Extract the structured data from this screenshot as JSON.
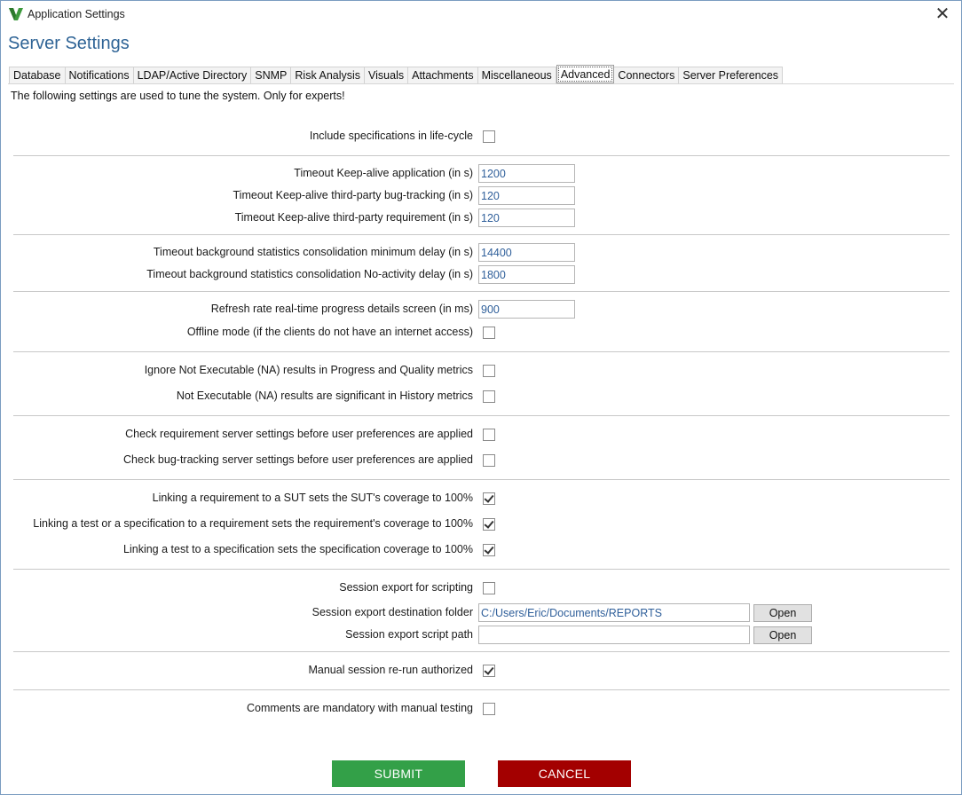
{
  "window": {
    "title": "Application Settings",
    "close_glyph": "✕"
  },
  "page_title": "Server Settings",
  "tabs": [
    {
      "label": "Database"
    },
    {
      "label": "Notifications"
    },
    {
      "label": "LDAP/Active Directory"
    },
    {
      "label": "SNMP"
    },
    {
      "label": "Risk Analysis"
    },
    {
      "label": "Visuals"
    },
    {
      "label": "Attachments"
    },
    {
      "label": "Miscellaneous"
    },
    {
      "label": "Advanced",
      "active": true
    },
    {
      "label": "Connectors"
    },
    {
      "label": "Server Preferences"
    }
  ],
  "intro": "The following settings are used to tune the system. Only for experts!",
  "settings": {
    "include_specs": {
      "label": "Include specifications in life-cycle",
      "checked": false
    },
    "timeout_app": {
      "label": "Timeout Keep-alive application (in s)",
      "value": "1200"
    },
    "timeout_bug": {
      "label": "Timeout Keep-alive third-party bug-tracking (in s)",
      "value": "120"
    },
    "timeout_req": {
      "label": "Timeout Keep-alive third-party requirement (in s)",
      "value": "120"
    },
    "bg_min_delay": {
      "label": "Timeout background statistics consolidation minimum delay (in s)",
      "value": "14400"
    },
    "bg_noact_delay": {
      "label": "Timeout background statistics consolidation No-activity delay (in s)",
      "value": "1800"
    },
    "refresh_rate": {
      "label": "Refresh rate real-time progress details screen (in ms)",
      "value": "900"
    },
    "offline_mode": {
      "label": "Offline mode (if the clients do not have an internet access)",
      "checked": false
    },
    "ignore_na": {
      "label": "Ignore Not Executable (NA) results in Progress and Quality metrics",
      "checked": false
    },
    "na_history": {
      "label": "Not Executable (NA) results are significant in History metrics",
      "checked": false
    },
    "check_req": {
      "label": "Check requirement server settings before user preferences are applied",
      "checked": false
    },
    "check_bug": {
      "label": "Check bug-tracking server settings before user preferences are applied",
      "checked": false
    },
    "link_req_sut": {
      "label": "Linking a requirement to a SUT sets the SUT's coverage to 100%",
      "checked": true
    },
    "link_test_req": {
      "label": "Linking a test or a specification to a requirement sets the requirement's coverage to 100%",
      "checked": true
    },
    "link_test_spec": {
      "label": "Linking a test to a specification sets the specification coverage to 100%",
      "checked": true
    },
    "session_export": {
      "label": "Session export for scripting",
      "checked": false
    },
    "export_folder": {
      "label": "Session export destination folder",
      "value": "C:/Users/Eric/Documents/REPORTS",
      "button": "Open"
    },
    "export_script": {
      "label": "Session export script path",
      "value": "",
      "button": "Open"
    },
    "manual_rerun": {
      "label": "Manual session re-run authorized",
      "checked": true
    },
    "comments_mandatory": {
      "label": "Comments are mandatory with manual testing",
      "checked": false
    }
  },
  "actions": {
    "submit": "SUBMIT",
    "cancel": "CANCEL"
  },
  "colors": {
    "accent": "#2f6496",
    "submit": "#33a048",
    "cancel": "#a30000"
  }
}
